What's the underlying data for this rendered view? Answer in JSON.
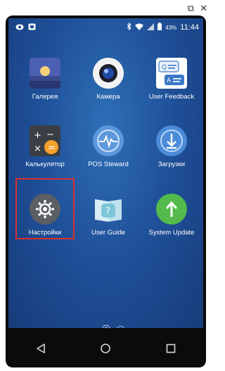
{
  "window_controls": {
    "restore": "⧉",
    "close": "✕"
  },
  "status_bar": {
    "battery_percent": "43%",
    "time": "11:44"
  },
  "apps": [
    {
      "label": "Галерея",
      "icon": "gallery-icon"
    },
    {
      "label": "Камера",
      "icon": "camera-icon"
    },
    {
      "label": "User Feedback",
      "icon": "user-feedback-icon"
    },
    {
      "label": "Калькулятор",
      "icon": "calculator-icon"
    },
    {
      "label": "POS Steward",
      "icon": "pos-steward-icon"
    },
    {
      "label": "Загрузки",
      "icon": "downloads-icon"
    },
    {
      "label": "Настройки",
      "icon": "settings-icon"
    },
    {
      "label": "User Guide",
      "icon": "user-guide-icon"
    },
    {
      "label": "System Update",
      "icon": "system-update-icon"
    }
  ],
  "page_indicator": {
    "current": "1"
  },
  "highlighted_app": "Настройки",
  "colors": {
    "highlight": "#d9302b",
    "screen_bg": "#1f4f98"
  }
}
